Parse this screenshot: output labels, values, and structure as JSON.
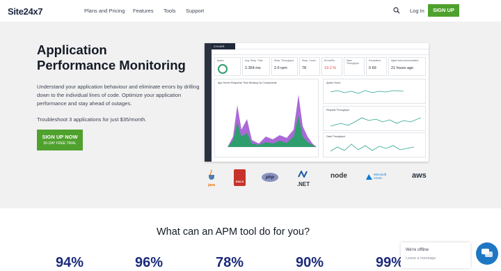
{
  "nav": {
    "logo": "Site24x7",
    "links": [
      "Plans and Pricing",
      "Features",
      "Tools",
      "Support"
    ],
    "login": "Log In",
    "signup": "SIGN UP"
  },
  "hero": {
    "title_line1": "Application",
    "title_line2": "Performance Monitoring",
    "description": "Understand your application behaviour and eliminate errors by drilling down to the individual lines of code. Optimize your application performance and stay ahead of outages.",
    "troubleshoot": "Troubleshoot 3 applications for just $35/month.",
    "cta_main": "SIGN UP NOW",
    "cta_sub": "30-DAY FREE TRIAL"
  },
  "dashboard": {
    "app_name": "ZYLKER",
    "kpis": [
      {
        "title": "Apdex",
        "value": ""
      },
      {
        "title": "Avg. Resp. Time",
        "value": "2.354 ms"
      },
      {
        "title": "Resp. Throughput",
        "value": "2.6 rpm"
      },
      {
        "title": "Resp. Count",
        "value": "78"
      },
      {
        "title": "Errors/Rs",
        "value": "19.2 %"
      },
      {
        "title": "Data Throughput",
        "value": ""
      },
      {
        "title": "Exceptions",
        "value": "0 69"
      },
      {
        "title": "Agent last communicated",
        "value": "21 hours ago"
      }
    ],
    "panels": {
      "main_chart": "App Server Response Time Breakup by Components",
      "apdex": "Apdex Score",
      "request_throughput": "Request Throughput",
      "data_throughput": "Data Throughput"
    },
    "colors": {
      "green": "#2f9e6e",
      "purple": "#9b4fd0",
      "line": "#2aa38c"
    }
  },
  "tech_logos": [
    "java",
    "RAILS",
    "php",
    ".NET",
    "node",
    "Microsoft Azure",
    "aws"
  ],
  "section": {
    "title": "What can an APM tool do for you?",
    "stats": [
      "94%",
      "96%",
      "78%",
      "90%",
      "99%"
    ]
  },
  "chat": {
    "status": "We're offline",
    "prompt": "Leave a message"
  }
}
